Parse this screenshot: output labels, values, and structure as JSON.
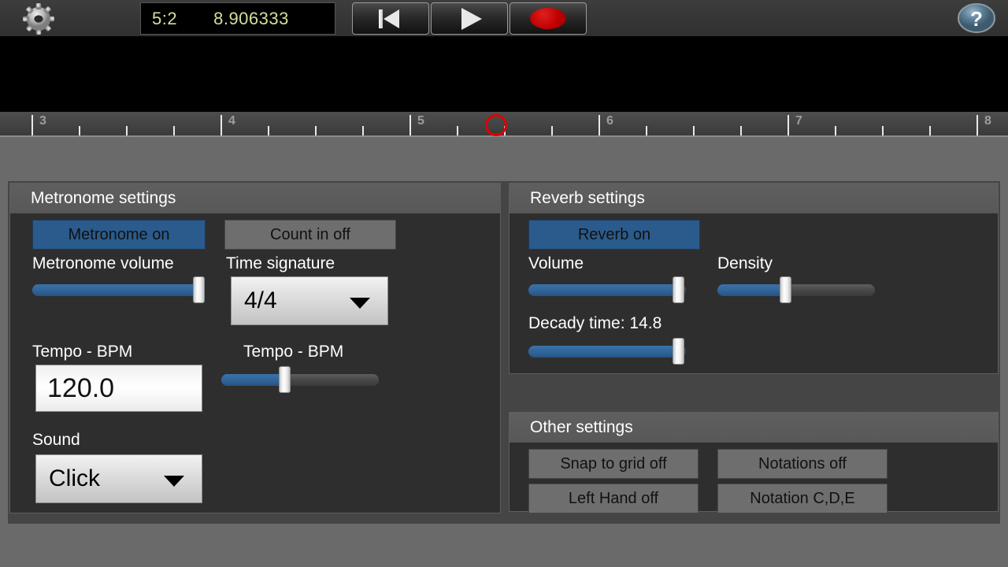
{
  "toolbar": {
    "gear_icon": "gear-icon",
    "help_icon": "help-question-icon",
    "display": {
      "bars_beats": "5:2",
      "seconds": "8.906333"
    },
    "transport": [
      {
        "name": "rewind-to-start-button",
        "icon": "skip-to-start-icon"
      },
      {
        "name": "play-button",
        "icon": "play-triangle-icon"
      },
      {
        "name": "record-button",
        "icon": "record-circle-icon"
      }
    ]
  },
  "ruler": {
    "bars": [
      "3",
      "4",
      "5",
      "6",
      "7",
      "8"
    ],
    "playhead_marker": "red-circle-playhead"
  },
  "metronome": {
    "title": "Metronome settings",
    "metronome_toggle": "Metronome on",
    "count_in_toggle": "Count in off",
    "volume_label": "Metronome volume",
    "volume_percent": 97,
    "time_signature_label": "Time signature",
    "time_signature_value": "4/4",
    "tempo_label": "Tempo - BPM",
    "tempo_value": "120.0",
    "tempo_slider_label": "Tempo - BPM",
    "tempo_percent": 40,
    "sound_label": "Sound",
    "sound_value": "Click"
  },
  "reverb": {
    "title": "Reverb settings",
    "reverb_toggle": "Reverb on",
    "volume_label": "Volume",
    "volume_percent": 95,
    "density_label": "Density",
    "density_percent": 43,
    "decay_label": "Decady time: 14.8",
    "decay_percent": 95
  },
  "other": {
    "title": "Other settings",
    "buttons": [
      "Snap to grid off",
      "Notations off",
      "Left Hand off",
      "Notation C,D,E"
    ]
  },
  "colors": {
    "accent_blue": "#2a5b8c",
    "toggle_off_gray": "#6e6e6e",
    "panel_bg": "#2e2e2e",
    "panel_header": "#5a5a5a",
    "page_bg": "#6a6a6a",
    "record_red": "#c00000",
    "display_green": "#cfe09a"
  }
}
